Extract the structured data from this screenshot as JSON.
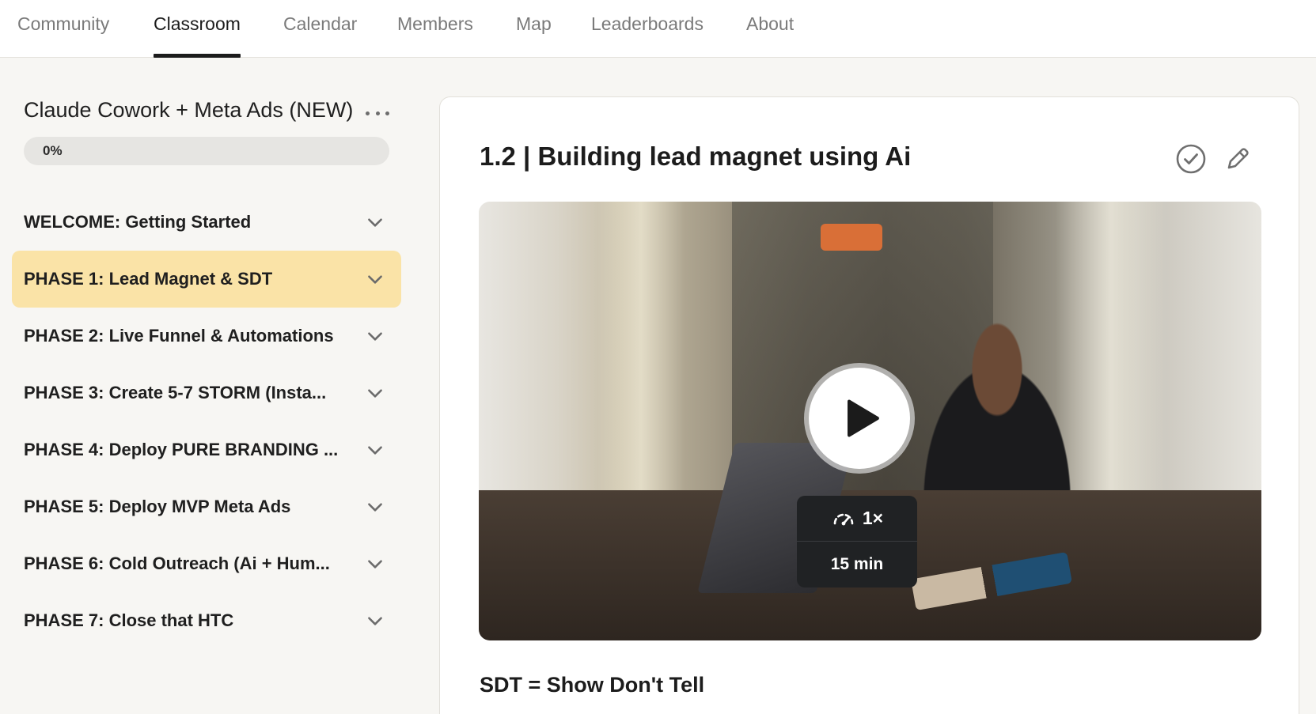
{
  "nav": {
    "tabs": [
      {
        "label": "Community"
      },
      {
        "label": "Classroom",
        "active": true
      },
      {
        "label": "Calendar"
      },
      {
        "label": "Members"
      },
      {
        "label": "Map"
      },
      {
        "label": "Leaderboards"
      },
      {
        "label": "About"
      }
    ]
  },
  "sidebar": {
    "course_title": "Claude Cowork + Meta Ads (NEW)",
    "progress": {
      "label": "0%",
      "value": 0
    },
    "modules": [
      {
        "label": "WELCOME: Getting Started"
      },
      {
        "label": "PHASE 1: Lead Magnet & SDT",
        "active": true
      },
      {
        "label": "PHASE 2: Live Funnel & Automations"
      },
      {
        "label": "PHASE 3: Create 5-7 STORM (Insta..."
      },
      {
        "label": "PHASE 4: Deploy PURE BRANDING ..."
      },
      {
        "label": "PHASE 5: Deploy MVP Meta Ads"
      },
      {
        "label": "PHASE 6: Cold Outreach (Ai + Hum..."
      },
      {
        "label": "PHASE 7: Close that HTC"
      }
    ]
  },
  "lesson": {
    "title": "1.2 | Building lead magnet using Ai",
    "video": {
      "speed": "1×",
      "duration": "15 min"
    },
    "subtitle": "SDT = Show Don't Tell"
  },
  "icons": {
    "course_menu": "more-horizontal-icon",
    "module_toggle": "chevron-down-icon",
    "complete": "check-circle-icon",
    "edit": "pencil-icon",
    "play": "play-icon",
    "speed": "playback-speed-icon"
  },
  "colors": {
    "active_module_bg": "#fae3a7",
    "progress_fill": "#f6d68a",
    "active_tab_underline": "#1c1c1c"
  }
}
